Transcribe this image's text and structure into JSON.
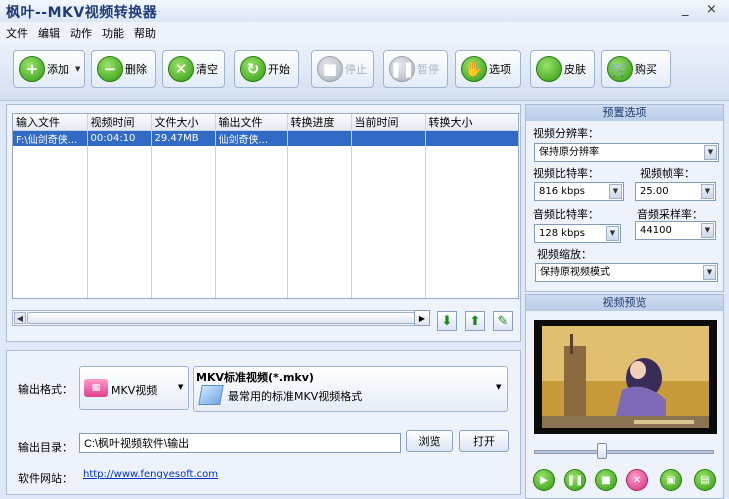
{
  "window": {
    "title": "枫叶--MKV视频转换器",
    "minimize": "_",
    "close": "×"
  },
  "menu": [
    "文件",
    "编辑",
    "动作",
    "功能",
    "帮助"
  ],
  "toolbar": {
    "add": "添加",
    "delete": "删除",
    "clear": "清空",
    "start": "开始",
    "stop": "停止",
    "pause": "暂停",
    "options": "选项",
    "skin": "皮肤",
    "buy": "购买"
  },
  "table": {
    "headers": [
      "输入文件",
      "视频时间",
      "文件大小",
      "输出文件",
      "转换进度",
      "当前时间",
      "转换大小"
    ],
    "rows": [
      [
        "F:\\仙剑奇侠...",
        "00:04:10",
        "29.47MB",
        "仙剑奇侠...",
        "",
        "",
        ""
      ]
    ]
  },
  "output": {
    "format_label": "输出格式：",
    "format_name": "MKV视频",
    "format_title": "MKV标准视频(*.mkv)",
    "format_desc": "最常用的标准MKV视频格式",
    "dir_label": "输出目录：",
    "dir_value": "C:\\枫叶视频软件\\输出",
    "browse": "浏览",
    "open": "打开",
    "site_label": "软件网站：",
    "site_url": "http://www.fengyesoft.com"
  },
  "presets": {
    "title": "预置选项",
    "resolution_label": "视频分辨率：",
    "resolution": "保持原分辨率",
    "video_bitrate_label": "视频比特率：",
    "video_bitrate": "816 kbps",
    "framerate_label": "视频帧率：",
    "framerate": "25.00",
    "audio_bitrate_label": "音频比特率：",
    "audio_bitrate": "128 kbps",
    "samplerate_label": "音频采样率：",
    "samplerate": "44100",
    "scale_label": "视频缩放：",
    "scale": "保持原视频模式"
  },
  "preview": {
    "title": "视频预览",
    "progress": 0.37
  },
  "colors": {
    "accent": "#316ac5",
    "brand": "#1e3d78"
  }
}
